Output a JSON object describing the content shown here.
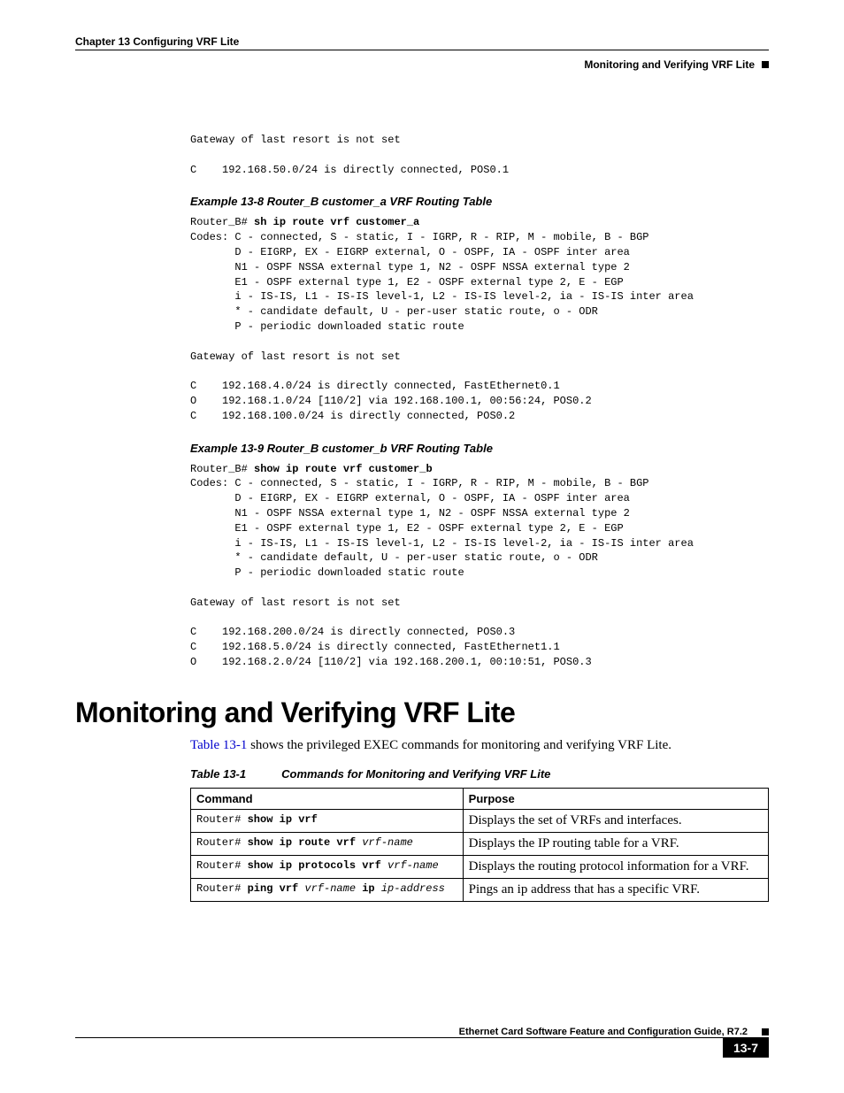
{
  "header": {
    "chapter": "Chapter 13    Configuring VRF Lite",
    "section": "Monitoring and Verifying VRF Lite"
  },
  "pre_intro": "Gateway of last resort is not set\n\nC    192.168.50.0/24 is directly connected, POS0.1",
  "example8": {
    "caption": "Example 13-8   Router_B customer_a VRF Routing Table",
    "prompt": "Router_B# ",
    "cmd": "sh ip route vrf customer_a",
    "body": "Codes: C - connected, S - static, I - IGRP, R - RIP, M - mobile, B - BGP\n       D - EIGRP, EX - EIGRP external, O - OSPF, IA - OSPF inter area\n       N1 - OSPF NSSA external type 1, N2 - OSPF NSSA external type 2\n       E1 - OSPF external type 1, E2 - OSPF external type 2, E - EGP\n       i - IS-IS, L1 - IS-IS level-1, L2 - IS-IS level-2, ia - IS-IS inter area\n       * - candidate default, U - per-user static route, o - ODR\n       P - periodic downloaded static route\n\nGateway of last resort is not set\n\nC    192.168.4.0/24 is directly connected, FastEthernet0.1\nO    192.168.1.0/24 [110/2] via 192.168.100.1, 00:56:24, POS0.2\nC    192.168.100.0/24 is directly connected, POS0.2"
  },
  "example9": {
    "caption": "Example 13-9   Router_B customer_b VRF Routing Table",
    "prompt": "Router_B# ",
    "cmd": "show ip route vrf customer_b",
    "body": "Codes: C - connected, S - static, I - IGRP, R - RIP, M - mobile, B - BGP\n       D - EIGRP, EX - EIGRP external, O - OSPF, IA - OSPF inter area\n       N1 - OSPF NSSA external type 1, N2 - OSPF NSSA external type 2\n       E1 - OSPF external type 1, E2 - OSPF external type 2, E - EGP\n       i - IS-IS, L1 - IS-IS level-1, L2 - IS-IS level-2, ia - IS-IS inter area\n       * - candidate default, U - per-user static route, o - ODR\n       P - periodic downloaded static route\n\nGateway of last resort is not set\n\nC    192.168.200.0/24 is directly connected, POS0.3\nC    192.168.5.0/24 is directly connected, FastEthernet1.1\nO    192.168.2.0/24 [110/2] via 192.168.200.1, 00:10:51, POS0.3"
  },
  "section_title": "Monitoring and Verifying VRF Lite",
  "body_text_prefix": "Table 13-1",
  "body_text_rest": " shows the privileged EXEC commands for monitoring and verifying VRF Lite.",
  "table": {
    "label": "Table 13-1",
    "title": "Commands for Monitoring and Verifying VRF Lite",
    "headers": {
      "c1": "Command",
      "c2": "Purpose"
    },
    "rows": [
      {
        "prompt": "Router# ",
        "bold": "show ip vrf",
        "italic": "",
        "purpose": "Displays the set of VRFs and interfaces."
      },
      {
        "prompt": "Router# ",
        "bold": "show ip route vrf ",
        "italic": "vrf-name",
        "purpose": "Displays the IP routing table for a VRF."
      },
      {
        "prompt": "Router# ",
        "bold": "show ip protocols vrf ",
        "italic": "vrf-name",
        "purpose": "Displays the routing protocol information for a VRF."
      },
      {
        "prompt": "Router# ",
        "bold": "ping vrf ",
        "italic": "vrf-name",
        "bold2": " ip ",
        "italic2": "ip-address",
        "purpose": "Pings an ip address that has a specific VRF."
      }
    ]
  },
  "footer": {
    "guide": "Ethernet Card Software Feature and Configuration Guide, R7.2",
    "page": "13-7"
  }
}
